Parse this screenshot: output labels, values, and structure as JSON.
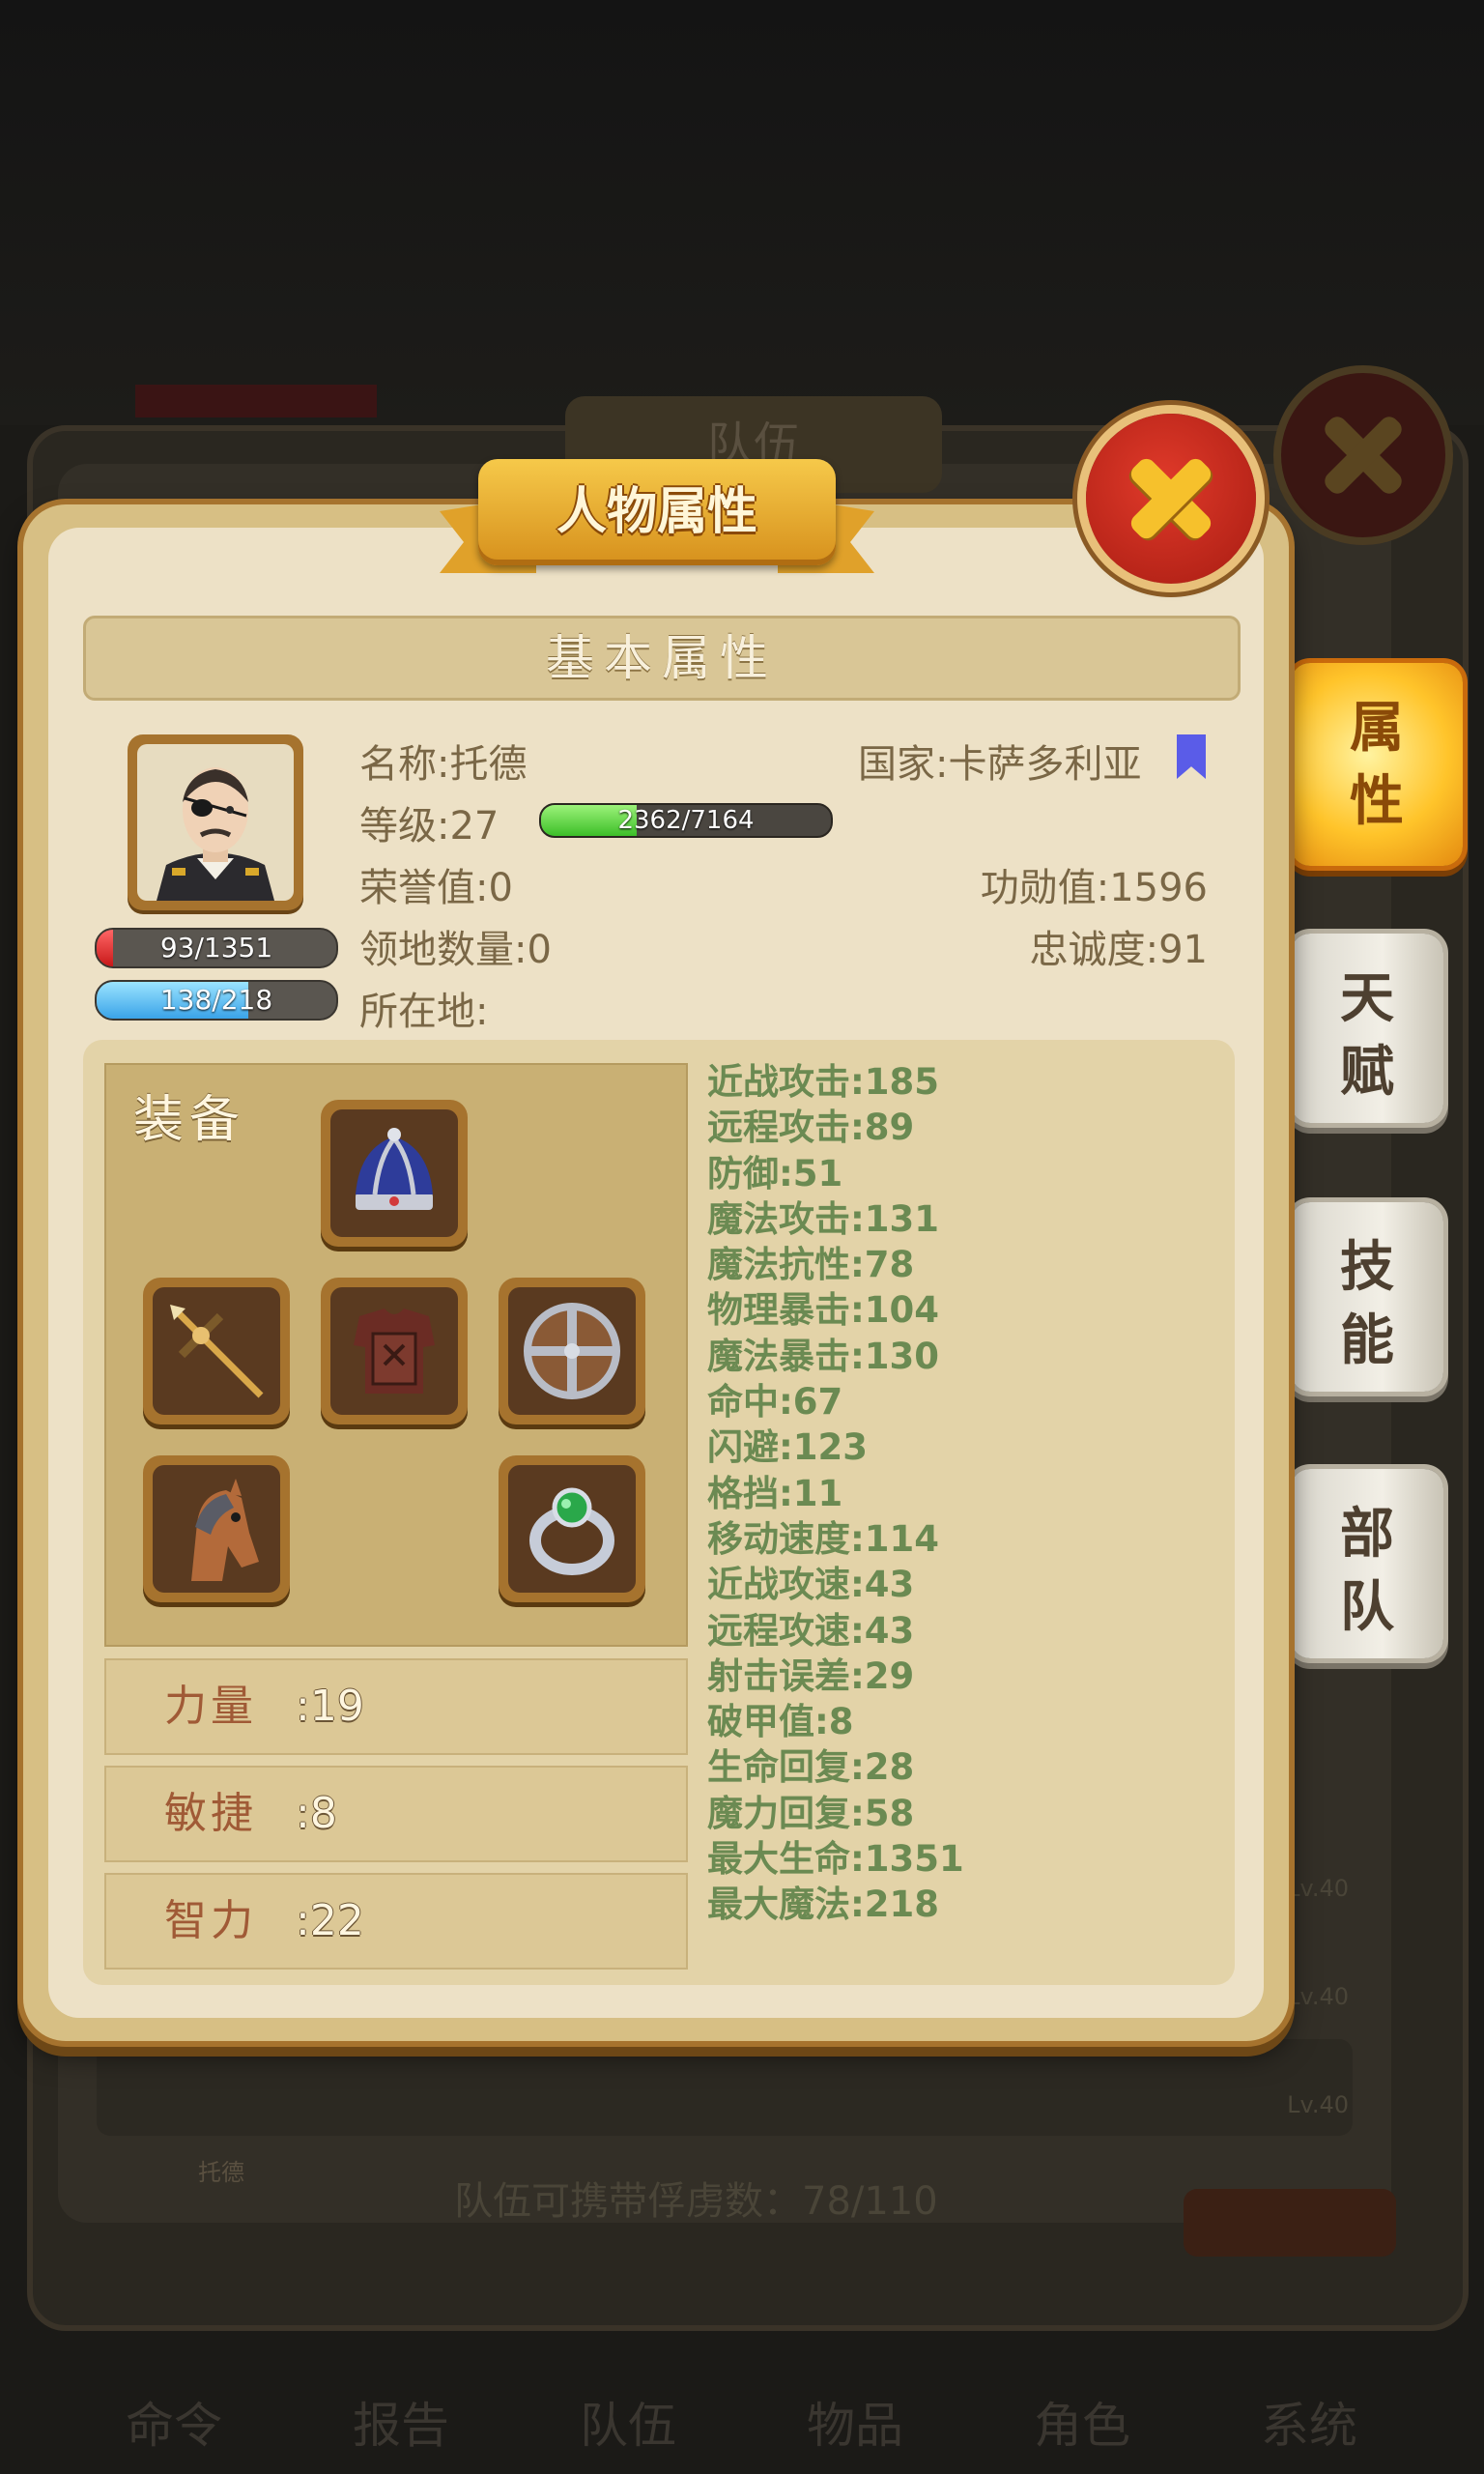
{
  "background": {
    "panel_title": "队伍",
    "hero_name": "托德",
    "caption": "队伍可携带俘虏数：78/110",
    "levels": [
      "Lv.40",
      "Lv.40",
      "Lv.40"
    ],
    "nav": [
      "命令",
      "报告",
      "队伍",
      "物品",
      "角色",
      "系统"
    ]
  },
  "dialog": {
    "title": "人物属性",
    "section_header": "基本属性",
    "close_icon": "close-x-icon"
  },
  "character": {
    "name": "名称:托德",
    "country": "国家:卡萨多利亚",
    "level": "等级:27",
    "exp": {
      "text": "2362/7164",
      "current": 2362,
      "max": 7164
    },
    "honor": "荣誉值:0",
    "merit": "功勋值:1596",
    "territory": "领地数量:0",
    "loyalty": "忠诚度:91",
    "location": "所在地:",
    "hp": {
      "text": "93/1351",
      "current": 93,
      "max": 1351
    },
    "mp": {
      "text": "138/218",
      "current": 138,
      "max": 218
    }
  },
  "equipment": {
    "title": "装备",
    "slots": [
      "crown-icon",
      "crossbow-icon",
      "armor-icon",
      "shield-icon",
      "horse-icon",
      "ring-icon"
    ]
  },
  "attributes": [
    {
      "label": "力量",
      "value": ":19"
    },
    {
      "label": "敏捷",
      "value": ":8"
    },
    {
      "label": "智力",
      "value": ":22"
    }
  ],
  "stats": [
    "近战攻击:185",
    "远程攻击:89",
    "防御:51",
    "魔法攻击:131",
    "魔法抗性:78",
    "物理暴击:104",
    "魔法暴击:130",
    "命中:67",
    "闪避:123",
    "格挡:11",
    "移动速度:114",
    "近战攻速:43",
    "远程攻速:43",
    "射击误差:29",
    "破甲值:8",
    "生命回复:28",
    "魔力回复:58",
    "最大生命:1351",
    "最大魔法:218"
  ],
  "side_tabs": [
    {
      "c1": "属",
      "c2": "性",
      "active": true
    },
    {
      "c1": "天",
      "c2": "赋",
      "active": false
    },
    {
      "c1": "技",
      "c2": "能",
      "active": false
    },
    {
      "c1": "部",
      "c2": "队",
      "active": false
    }
  ],
  "colors": {
    "stat_text": "#6b8a52",
    "info_text": "#7a6746",
    "close_red": "#c8281a",
    "flag_blue": "#5a5ce8"
  }
}
